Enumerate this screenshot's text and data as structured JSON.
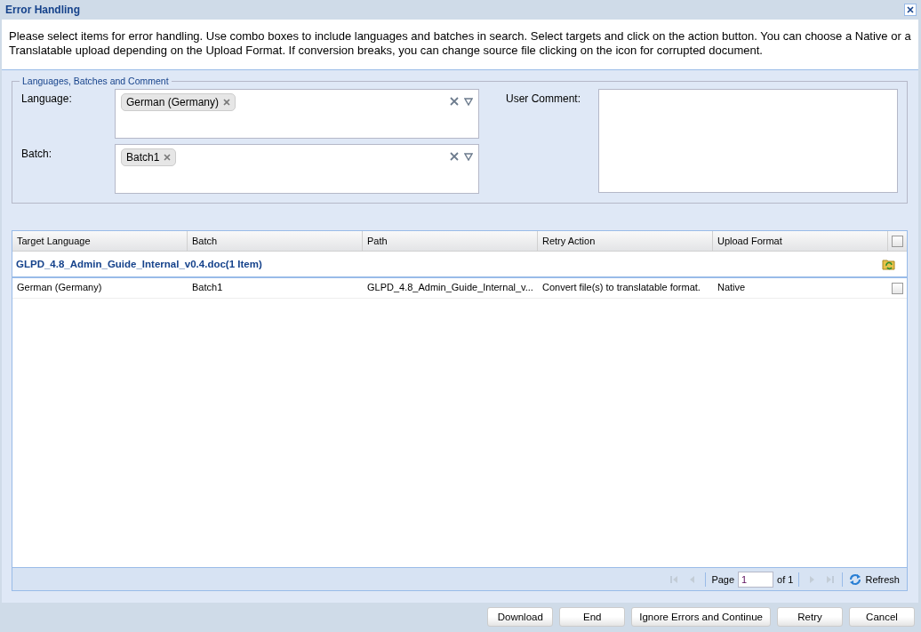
{
  "window": {
    "title": "Error Handling"
  },
  "description": "Please select items for error handling. Use combo boxes to include languages and batches in search. Select targets and click on the action button. You can choose a Native or a Translatable upload depending on the Upload Format. If conversion breaks, you can change source file clicking on the icon for corrupted document.",
  "filters": {
    "legend": "Languages, Batches and Comment",
    "combos": [
      {
        "label": "Language:",
        "tags": [
          "German (Germany)"
        ]
      },
      {
        "label": "Batch:",
        "tags": [
          "Batch1"
        ]
      }
    ],
    "comment": {
      "label": "User Comment:"
    }
  },
  "grid": {
    "columns": [
      "Target Language",
      "Batch",
      "Path",
      "Retry Action",
      "Upload Format"
    ],
    "header_checked": false,
    "groups": [
      {
        "title": "GLPD_4.8_Admin_Guide_Internal_v0.4.doc(1 Item)",
        "rows": [
          {
            "cells": [
              "German (Germany)",
              "Batch1",
              "GLPD_4.8_Admin_Guide_Internal_v...",
              "Convert file(s) to translatable format.",
              "Native"
            ],
            "checked": false
          }
        ]
      }
    ]
  },
  "pager": {
    "page_label": "Page",
    "page": "1",
    "of": "of 1",
    "refresh": "Refresh"
  },
  "buttons": [
    "Download",
    "End",
    "Ignore Errors and Continue",
    "Retry",
    "Cancel"
  ]
}
